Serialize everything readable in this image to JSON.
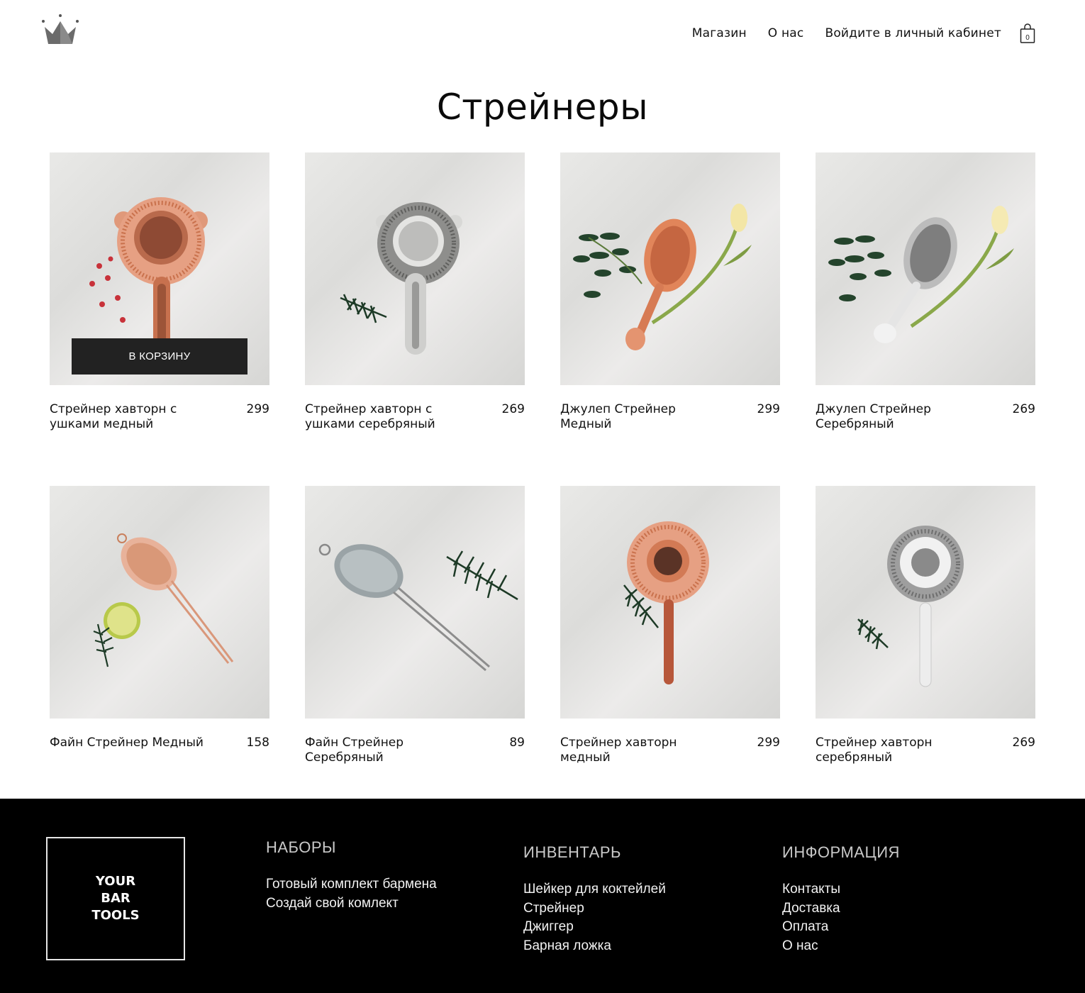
{
  "header": {
    "nav": [
      {
        "label": "Магазин"
      },
      {
        "label": "О нас"
      },
      {
        "label": "Войдите в личный кабинет"
      }
    ],
    "cart_count": "0",
    "icons": {
      "logo": "crown-icon",
      "cart": "shopping-bag-icon"
    }
  },
  "page_title": "Стрейнеры",
  "add_to_cart_label": "В КОРЗИНУ",
  "products": [
    {
      "name": "Стрейнер хавторн с ушками медный",
      "price": "299",
      "finish": "copper"
    },
    {
      "name": "Стрейнер хавторн с ушками серебряный",
      "price": "269",
      "finish": "silver"
    },
    {
      "name": "Джулеп Стрейнер Медный",
      "price": "299",
      "finish": "copper"
    },
    {
      "name": "Джулеп Стрейнер Серебряный",
      "price": "269",
      "finish": "silver"
    },
    {
      "name": "Файн Стрейнер Медный",
      "price": "158",
      "finish": "copper"
    },
    {
      "name": "Файн Стрейнер Серебряный",
      "price": "89",
      "finish": "silver"
    },
    {
      "name": "Стрейнер хавторн медный",
      "price": "299",
      "finish": "copper"
    },
    {
      "name": "Стрейнер хавторн серебряный",
      "price": "269",
      "finish": "silver"
    }
  ],
  "footer": {
    "brand": [
      "YOUR",
      "BAR",
      "TOOLS"
    ],
    "columns": [
      {
        "title": "НАБОРЫ",
        "links": [
          "Готовый комплект бармена",
          "Создай свой комлект"
        ]
      },
      {
        "title": "ИНВЕНТАРЬ",
        "links": [
          "Шейкер для коктейлей",
          "Стрейнер",
          "Джиггер",
          "Барная ложка"
        ]
      },
      {
        "title": "ИНФОРМАЦИЯ",
        "links": [
          "Контакты",
          "Доставка",
          "Оплата",
          "О нас"
        ]
      }
    ]
  },
  "colors": {
    "copper": "#d9825e",
    "silver": "#b9b9b9",
    "button_bg": "#222222",
    "footer_bg": "#000000"
  }
}
